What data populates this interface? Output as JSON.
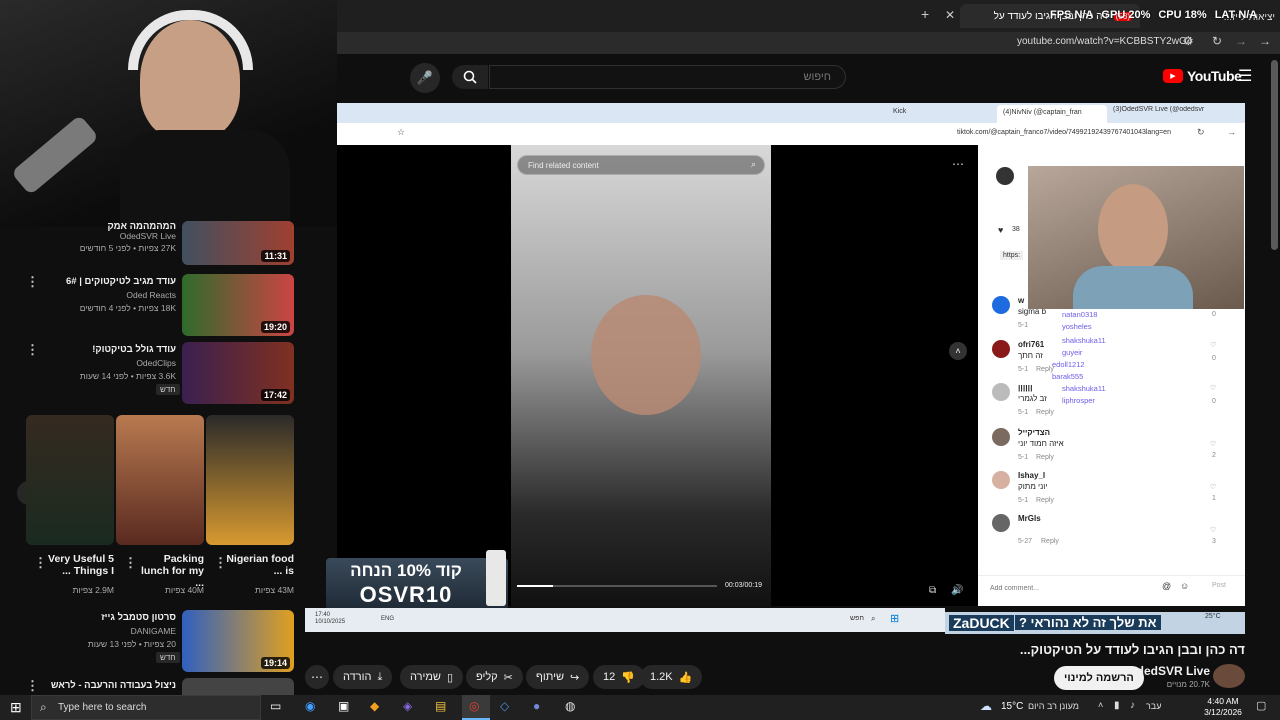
{
  "browser": {
    "tab_active_title": "דה כהן ובבן הגיבו לעודד על",
    "tab_other_title": "יציאות לייז...",
    "tab_badge": "(58)",
    "url": "youtube.com/watch?v=KCBBSTY2wG4",
    "overlay_stats": {
      "fps_label": "FPS",
      "fps_value": "N/A",
      "gpu_label": "GPU",
      "gpu_value": "20%",
      "cpu_label": "CPU",
      "cpu_value": "18%",
      "lat_label": "LAT",
      "lat_value": "N/A"
    }
  },
  "youtube": {
    "logo_text": "YouTube",
    "search_placeholder": "חיפוש",
    "search_value": ""
  },
  "inner_browser": {
    "tabs": [
      "(3)OdedSVR Live (@odedsvr",
      "(4)NivNiv (@captain_fran",
      "Kick"
    ],
    "url": "tiktok.com/@captain_franco7/video/74992192439767401043lang=en",
    "find_placeholder": "Find related content",
    "time": "00:03/00:19",
    "likes_count": "38",
    "link_preview": "https:",
    "add_comment_placeholder": "Add comment...",
    "post_label": "Post",
    "comments": [
      {
        "name": "w",
        "text": "sigma b",
        "date": "5-1",
        "reply": "Reply",
        "likes": "0"
      },
      {
        "name": "ofri761",
        "text": "זה חתך",
        "date": "5-1",
        "reply": "Reply",
        "likes": "0"
      },
      {
        "name": "ןןןןןן",
        "text": "זב לגמרי",
        "date": "5-1",
        "reply": "Reply",
        "likes": "0"
      },
      {
        "name": "הצדיקייל",
        "text": "איזה חמוד יוני",
        "date": "5-1",
        "reply": "Reply",
        "likes": "2"
      },
      {
        "name": "Ishay_l",
        "text": "יוני מתוק",
        "date": "5-1",
        "reply": "Reply",
        "likes": "1"
      },
      {
        "name": "MrGls",
        "text": "",
        "date": "5-27",
        "reply": "Reply",
        "likes": "3"
      }
    ],
    "chat": [
      "natan0318",
      "yosheles",
      "shakshuka11",
      "guyeir",
      "edoll1212",
      "barak555",
      "shakshuka11",
      "liphrosper"
    ]
  },
  "stream": {
    "promo_text": "קוד 10% הנחה",
    "promo_code": "OSVR10",
    "chat_banner_user": "ZaDUCK",
    "chat_banner_text": "את שלך זה לא נהוראי ?",
    "clock_time": "17:40",
    "clock_date": "10/10/2025",
    "lang": "ENG",
    "search_hint": "חפש",
    "temp": "25°C"
  },
  "video": {
    "title": "דה כהן ובבן הגיבו לעודד על הטיקטוק...",
    "channel_name": "OdedSVR Live",
    "subscribers": "20.7K מנויים",
    "subscribe_label": "הרשמה למינוי",
    "likes": "1.2K",
    "dislikes": "12",
    "share_label": "שיתוף",
    "clip_label": "קליפ",
    "save_label": "שמירה",
    "download_label": "הורדה"
  },
  "sidebar": {
    "items": [
      {
        "title": "המהמהמה אמק",
        "channel": "OdedSVR Live",
        "meta": "27K צפיות • לפני 5 חודשים",
        "duration": "11:31"
      },
      {
        "title": "עודד מגיב לטיקטוקים | 6#",
        "channel": "Oded Reacts",
        "meta": "18K צפיות • לפני 4 חודשים",
        "duration": "19:20"
      },
      {
        "title": "עודד גולל בטיקטוק!",
        "channel": "OdedClips",
        "meta": "3.6K צפיות • לפני 14 שעות",
        "badge": "חדש",
        "duration": "17:42"
      },
      {
        "title": "סרטון סטמבל גייז",
        "channel": "DANIGAME",
        "meta": "20 צפיות • לפני 13 שעות",
        "badge": "חדש",
        "duration": "19:14"
      },
      {
        "title": "ניצול בעבודה והרעבה - לראש",
        "channel": "",
        "meta": "",
        "duration": ""
      }
    ],
    "shorts": [
      {
        "title": "Nigerian food is ...",
        "views": "43M צפיות"
      },
      {
        "title": "Packing lunch for my ...",
        "views": "40M צפיות"
      },
      {
        "title": "Very Useful 5 Things I ...",
        "views": "2.9M צפיות"
      }
    ]
  },
  "taskbar": {
    "search_placeholder": "Type here to search",
    "weather_temp": "15°C",
    "weather_text": "מעונן רב היום",
    "lang": "עבר",
    "time": "4:40 AM",
    "date": "3/12/2026"
  }
}
